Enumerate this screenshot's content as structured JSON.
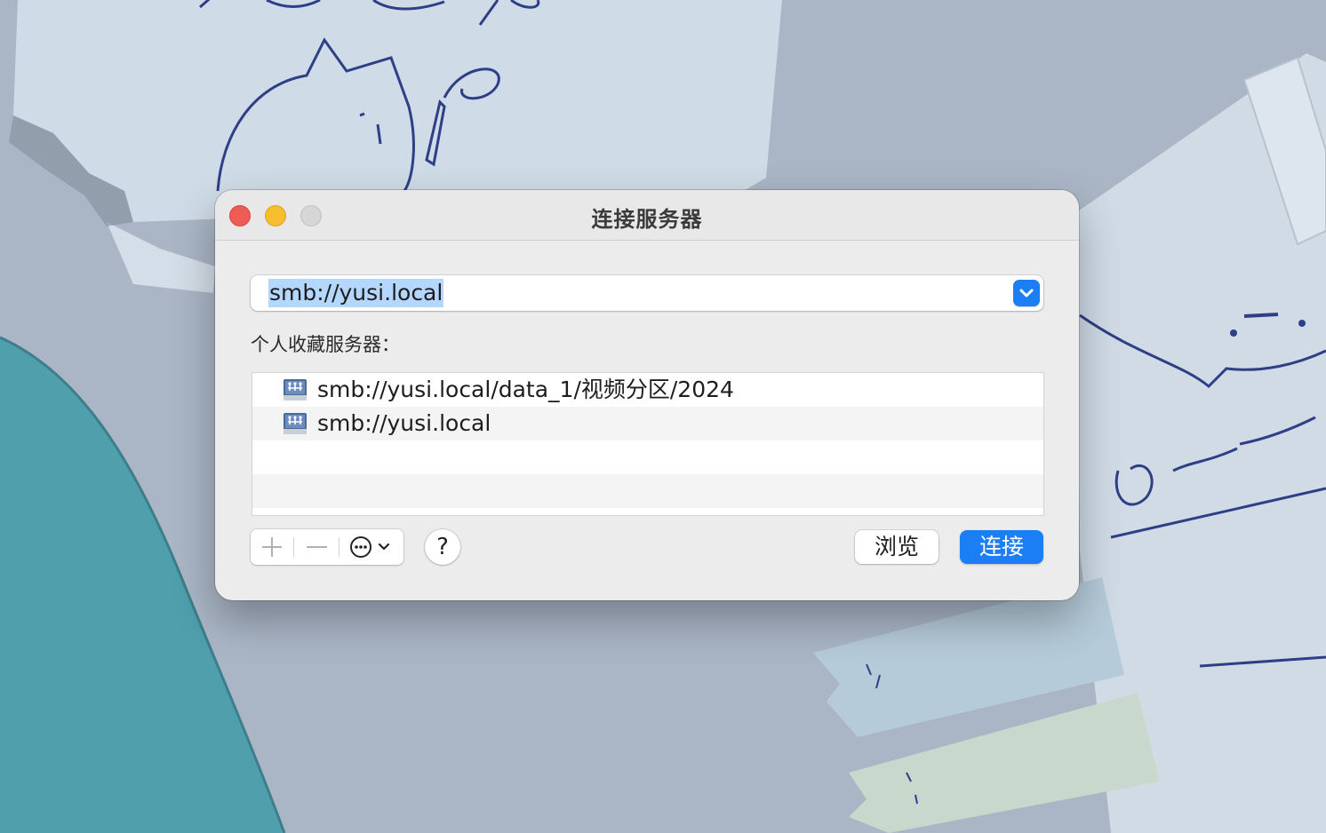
{
  "window": {
    "title": "连接服务器"
  },
  "address": {
    "value": "smb://yusi.local"
  },
  "favorites": {
    "label": "个人收藏服务器：",
    "items": [
      {
        "label": "smb://yusi.local/data_1/视频分区/2024",
        "icon": "network-server-icon"
      },
      {
        "label": "smb://yusi.local",
        "icon": "network-server-icon"
      }
    ]
  },
  "toolbar": {
    "add_icon": "plus-icon",
    "remove_icon": "minus-icon",
    "more_icon": "ellipsis-circle-icon",
    "help_label": "?",
    "browse_label": "浏览",
    "connect_label": "连接"
  },
  "colors": {
    "accent": "#1c7ef5",
    "selection": "#b3d7ff",
    "close": "#ee5c54",
    "minimize": "#f6bd2f"
  }
}
